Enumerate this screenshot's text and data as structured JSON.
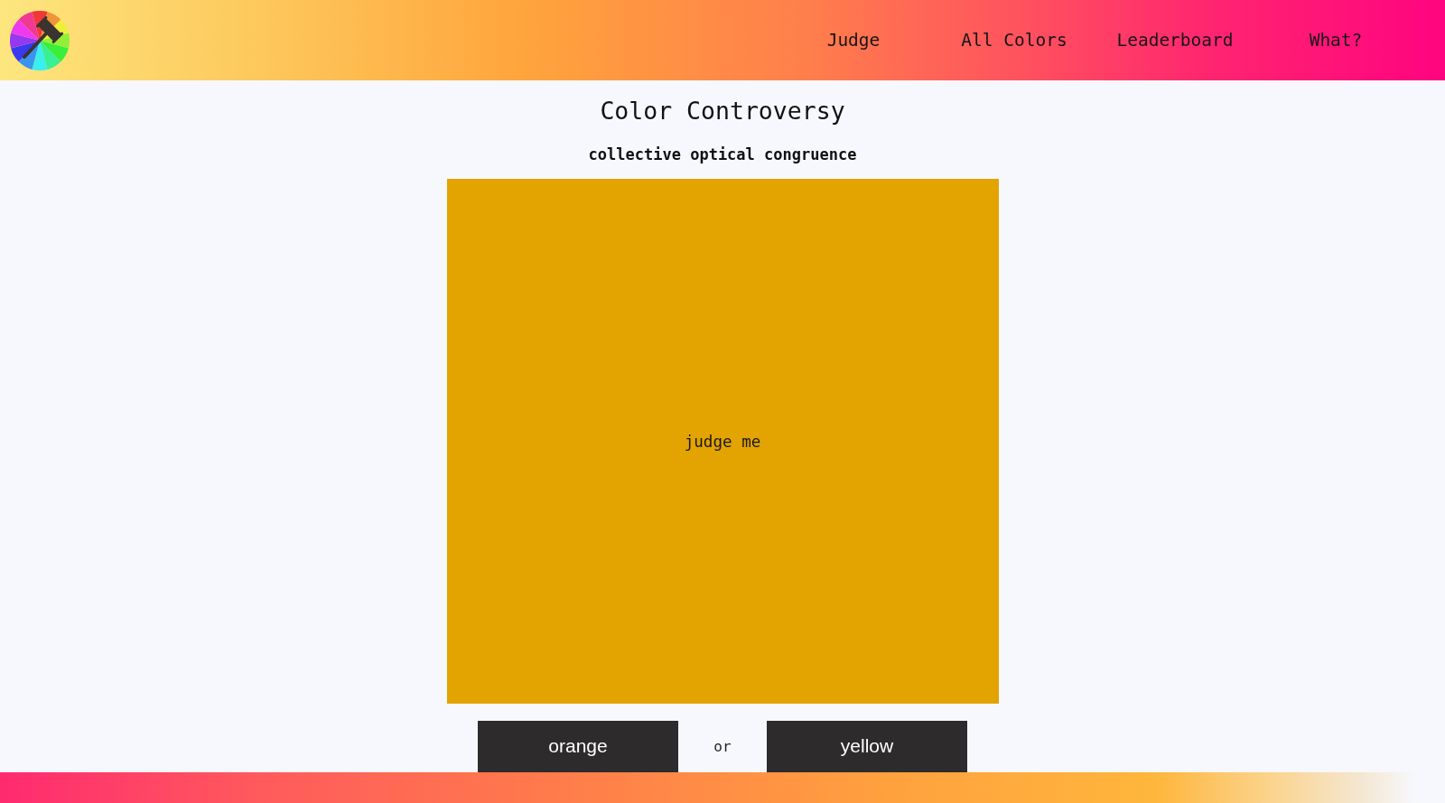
{
  "header": {
    "nav": [
      {
        "label": "Judge"
      },
      {
        "label": "All Colors"
      },
      {
        "label": "Leaderboard"
      },
      {
        "label": "What?"
      }
    ]
  },
  "title": "Color Controversy",
  "subtitle": "collective optical congruence",
  "swatch": {
    "color": "#e3a300",
    "label": "judge me"
  },
  "choices": [
    {
      "label": "orange"
    },
    {
      "label": "yellow"
    }
  ],
  "separator": "or"
}
